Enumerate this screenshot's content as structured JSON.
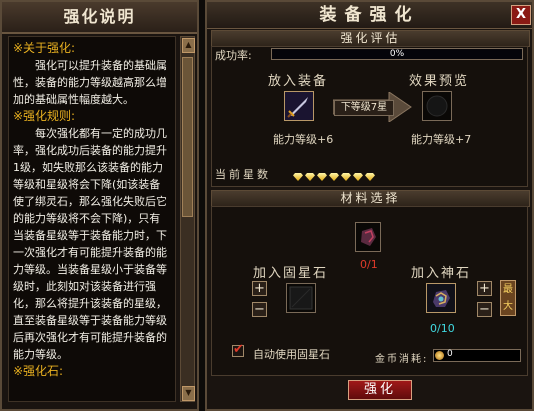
{
  "left": {
    "title": "强化说明",
    "sections": [
      {
        "heading": "※关于强化:",
        "paragraphs": [
          "强化可以提升装备的基础属性，装备的能力等级越高那么增加的基础属性幅度越大。"
        ]
      },
      {
        "heading": "※强化规则:",
        "paragraphs": [
          "每次强化都有一定的成功几率，强化成功后装备的能力提升1级，如失败那么该装备的能力等级和星级将会下降(如该装备使了绑灵石，那么强化失败后它的能力等级将不会下降)，只有当装备星级等于装备能力时，下一次强化才有可能提升装备的能力等级。当装备星级小于装备等级时，此刻如对该装备进行强化，那么将提升该装备的星级，直至装备星级等于装备能力等级后再次强化才有可能提升装备的能力等级。"
        ]
      },
      {
        "heading": "※强化石:",
        "paragraphs": []
      }
    ],
    "scroll_up": "▲",
    "scroll_down": "▼"
  },
  "right": {
    "title": "装备强化",
    "close": "X",
    "eval_header": "强化评估",
    "success_label": "成功率:",
    "success_value": "0%",
    "equip_label": "放入装备",
    "preview_label": "效果预览",
    "current_level": "能力等级+6",
    "preview_level": "能力等级+7",
    "arrow_text": "下等级7星",
    "stars_label": "当前星数",
    "stars_count": 7,
    "material_header": "材料选择",
    "fix_stone_label": "加入固星石",
    "fix_stone_count": "0/1",
    "god_stone_label": "加入神石",
    "god_stone_count": "0/10",
    "plus": "+",
    "minus": "−",
    "max_label": "最大",
    "auto_label": "自动使用固星石",
    "auto_checked": "✔",
    "coin_label": "金币消耗:",
    "coin_value": "0",
    "strengthen_button": "强化",
    "colors": {
      "red_count": "#e03a2a",
      "cyan_count": "#40d8e0",
      "gold": "#e8b020"
    }
  }
}
